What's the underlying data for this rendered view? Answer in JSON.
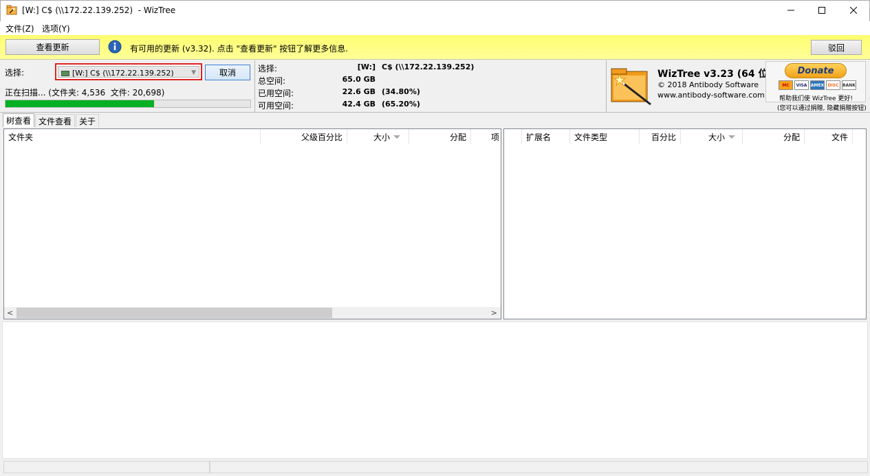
{
  "window": {
    "title": "[W:] C$ (\\\\172.22.139.252)  - WizTree",
    "controls": {
      "minimize": "—",
      "maximize": "☐",
      "close": "✕"
    }
  },
  "menu": {
    "file": "文件(Z)",
    "options": "选项(Y)"
  },
  "update_bar": {
    "check_update_label": "查看更新",
    "message": "有可用的更新 (v3.32). 点击 \"查看更新\" 按钮了解更多信息.",
    "back_label": "驳回"
  },
  "scan": {
    "select_label": "选择:",
    "drive_value": "[W:] C$ (\\\\172.22.139.252)",
    "cancel_label": "取消",
    "status": "正在扫描... (文件夹: 4,536  文件: 20,698)",
    "progress_fraction": 0.607
  },
  "drive_info": {
    "rows": [
      {
        "label": "选择:",
        "value": "[W:]",
        "extra": "C$ (\\\\172.22.139.252)"
      },
      {
        "label": "总空间:",
        "value": "65.0 GB",
        "extra": ""
      },
      {
        "label": "已用空间:",
        "value": "22.6 GB",
        "extra": "(34.80%)"
      },
      {
        "label": "可用空间:",
        "value": "42.4 GB",
        "extra": "(65.20%)"
      }
    ]
  },
  "about": {
    "product": "WizTree v3.23 (64 位)",
    "copyright": "© 2018 Antibody Software",
    "website": "www.antibody-software.com"
  },
  "donate": {
    "button_label": "Donate",
    "cards": [
      "MC",
      "VISA",
      "AMEX",
      "DISC",
      "BANK"
    ],
    "help_text": "帮助我们使 WizTree 更好!",
    "note": "(您可以通过捐赠, 隐藏捐赠按钮)"
  },
  "tabs": [
    "树查看",
    "文件查看",
    "关于"
  ],
  "tree_columns": [
    "文件夹",
    "父级百分比",
    "大小",
    "分配",
    "项"
  ],
  "ext_columns": [
    "扩展名",
    "文件类型",
    "百分比",
    "大小",
    "分配",
    "文件"
  ],
  "scroll": {
    "left_arrow": "<",
    "right_arrow": ">"
  },
  "colors": {
    "accent": "#3d7fd6",
    "progress": "#06b025",
    "update_bar": "#ffff88",
    "highlight_border": "#e02020"
  }
}
